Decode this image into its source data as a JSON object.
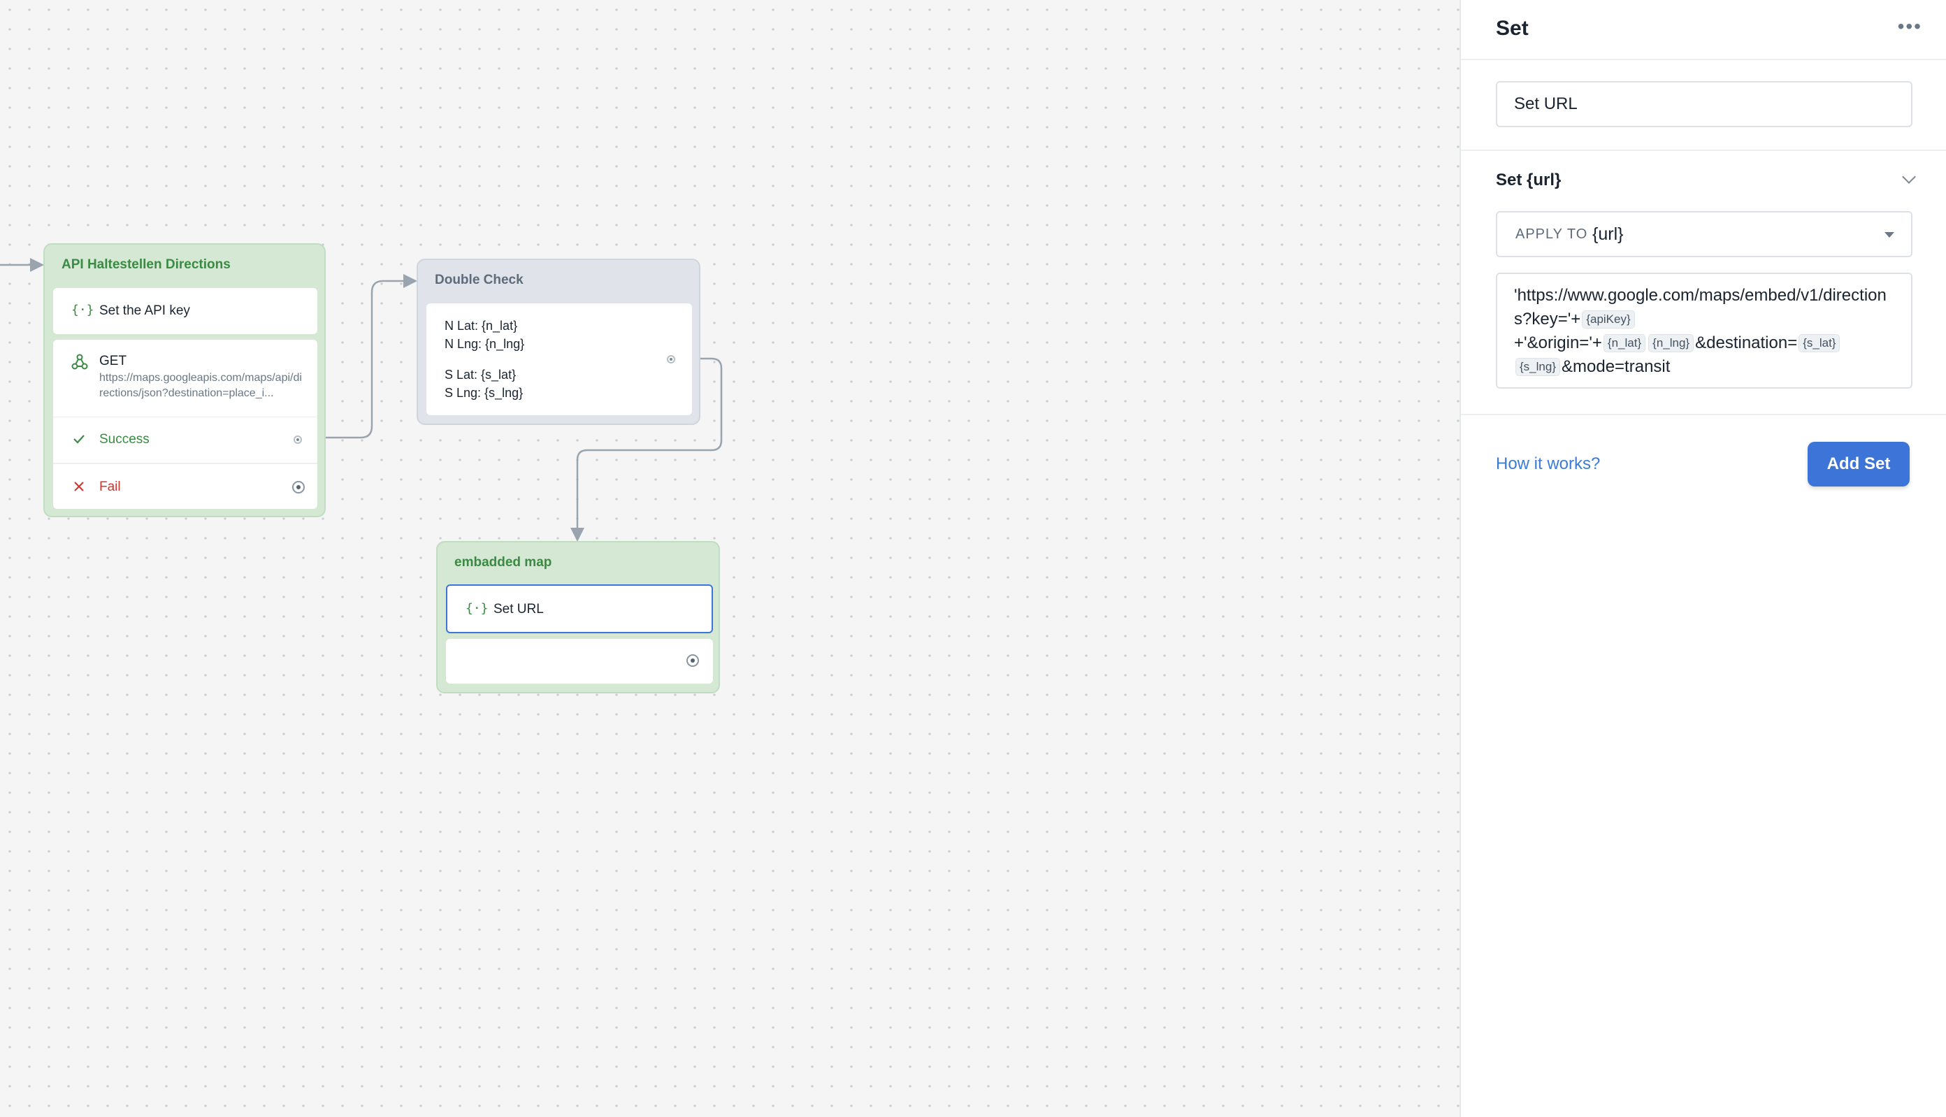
{
  "canvas": {
    "blocks": {
      "api": {
        "title": "API Haltestellen Directions",
        "set_step": "Set the API key",
        "get_method": "GET",
        "get_url": "https://maps.googleapis.com/maps/api/directions/json?destination=place_i...",
        "success_label": "Success",
        "fail_label": "Fail"
      },
      "double_check": {
        "title": "Double Check",
        "line1": "N Lat: {n_lat}",
        "line2": "N Lng: {n_lng}",
        "line3": "S Lat: {s_lat}",
        "line4": "S Lng: {s_lng}"
      },
      "map": {
        "title": "embadded map",
        "set_step": "Set URL"
      }
    }
  },
  "panel": {
    "title": "Set",
    "step_name": "Set URL",
    "section_title": "Set {url}",
    "apply_to_label": "APPLY TO",
    "apply_to_value": "{url}",
    "expression": {
      "part1": "'https://www.google.com/maps/embed/v1/directions?key='+",
      "chip_apikey": "{apiKey}",
      "part2": "+'&origin='+",
      "chip_n_lat": "{n_lat}",
      "chip_n_lng": "{n_lng}",
      "part3": "&destination=",
      "chip_s_lat": "{s_lat}",
      "chip_s_lng": "{s_lng}",
      "part4": "&mode=transit"
    },
    "help_link": "How it works?",
    "add_button": "Add Set"
  },
  "icons": {
    "variable": "variable-icon",
    "api": "api-webhook-icon",
    "check": "checkmark-icon",
    "fail": "close-x-icon",
    "more": "more-dots-icon",
    "chevron": "chevron-down-icon",
    "caret": "caret-down-icon"
  },
  "colors": {
    "accent_blue": "#3d74d8",
    "success_green": "#3b8a44",
    "fail_red": "#d0342c",
    "block_green": "#d4e8d3",
    "block_grey": "#e0e4ea"
  }
}
